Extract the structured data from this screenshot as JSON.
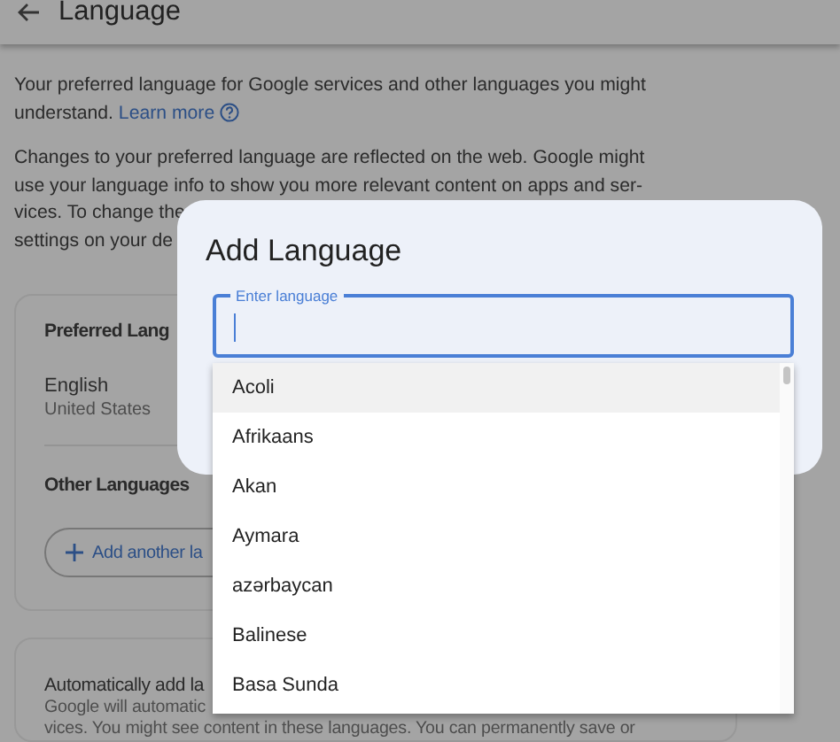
{
  "header": {
    "title": "Language"
  },
  "intro": {
    "lines": [
      "Your preferred language for Google services and other languages you might",
      "understand."
    ],
    "link": "Learn more"
  },
  "notice": {
    "lines": [
      "Changes to your preferred language are reflected on the web. Google might",
      "use your language info to show you more relevant content on apps and ser-",
      "vices. To change the",
      "settings on your de"
    ]
  },
  "preferred_card": {
    "heading": "Preferred Lang",
    "language": "English",
    "region": "United States",
    "other_heading": "Other Languages",
    "add_button": "Add another la"
  },
  "auto_card": {
    "heading": "Automatically add la",
    "lines": [
      "Google will automatic",
      "vices. You might see content in these languages. You can permanently save or"
    ]
  },
  "dialog": {
    "title": "Add Language",
    "field": {
      "label": "Enter language",
      "focused": true
    },
    "options": [
      {
        "label": "Acoli",
        "highlighted": true
      },
      {
        "label": "Afrikaans",
        "highlighted": false
      },
      {
        "label": "Akan",
        "highlighted": false
      },
      {
        "label": "Aymara",
        "highlighted": false
      },
      {
        "label": "azərbaycan",
        "highlighted": false
      },
      {
        "label": "Balinese",
        "highlighted": false
      },
      {
        "label": "Basa Sunda",
        "highlighted": false
      }
    ]
  }
}
